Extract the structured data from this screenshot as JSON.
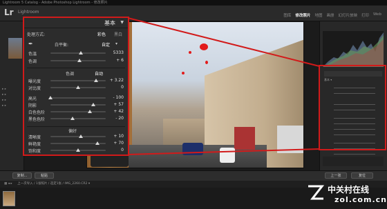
{
  "window": {
    "title": "Lightroom 5 Catalog - Adobe Photoshop Lightroom - 修改照片"
  },
  "app": {
    "logo": "Lr",
    "logo_sub": "Lightroom"
  },
  "modules": [
    {
      "label": "图库",
      "active": false
    },
    {
      "label": "修改照片",
      "active": true
    },
    {
      "label": "地图",
      "active": false
    },
    {
      "label": "画册",
      "active": false
    },
    {
      "label": "幻灯片放映",
      "active": false
    },
    {
      "label": "打印",
      "active": false
    },
    {
      "label": "Web",
      "active": false
    }
  ],
  "basic_panel": {
    "title": "基本",
    "treatment": {
      "label": "处理方式:",
      "color": "彩色",
      "bw": "黑白"
    },
    "white_balance": {
      "label": "白平衡:",
      "value": "自定"
    },
    "wb_sliders": [
      {
        "label": "色温",
        "value": "5333",
        "pos": 0.55
      },
      {
        "label": "色调",
        "value": "+ 6",
        "pos": 0.53
      }
    ],
    "tone_header": {
      "label": "色调",
      "auto": "自动"
    },
    "exposure": [
      {
        "label": "曝光度",
        "value": "+ 3.22",
        "pos": 0.82
      },
      {
        "label": "对比度",
        "value": "0",
        "pos": 0.5
      }
    ],
    "tone_sliders": [
      {
        "label": "高光",
        "value": "- 100",
        "pos": 0.0
      },
      {
        "label": "阴影",
        "value": "+ 57",
        "pos": 0.78
      },
      {
        "label": "白色色阶",
        "value": "+ 42",
        "pos": 0.71
      },
      {
        "label": "黑色色阶",
        "value": "- 20",
        "pos": 0.4
      }
    ],
    "presence_header": "偏好",
    "presence_sliders": [
      {
        "label": "清晰度",
        "value": "+ 10",
        "pos": 0.55
      },
      {
        "label": "鲜艳度",
        "value": "+ 70",
        "pos": 0.85
      },
      {
        "label": "饱和度",
        "value": "0",
        "pos": 0.5
      }
    ]
  },
  "toolbar": {
    "copy": "复制...",
    "paste": "粘贴",
    "prev": "上一张",
    "reset": "复位"
  },
  "filmstrip_bar": {
    "path": "上一次导入 / 1张照片 / 选定1张 / IMG_2260.CR2 ▾"
  },
  "watermark": {
    "line1": "中关村在线",
    "line2": "zol.com.cn"
  },
  "colors": {
    "callout": "#d21a1a",
    "panel_bg": "#2c2c2c"
  }
}
